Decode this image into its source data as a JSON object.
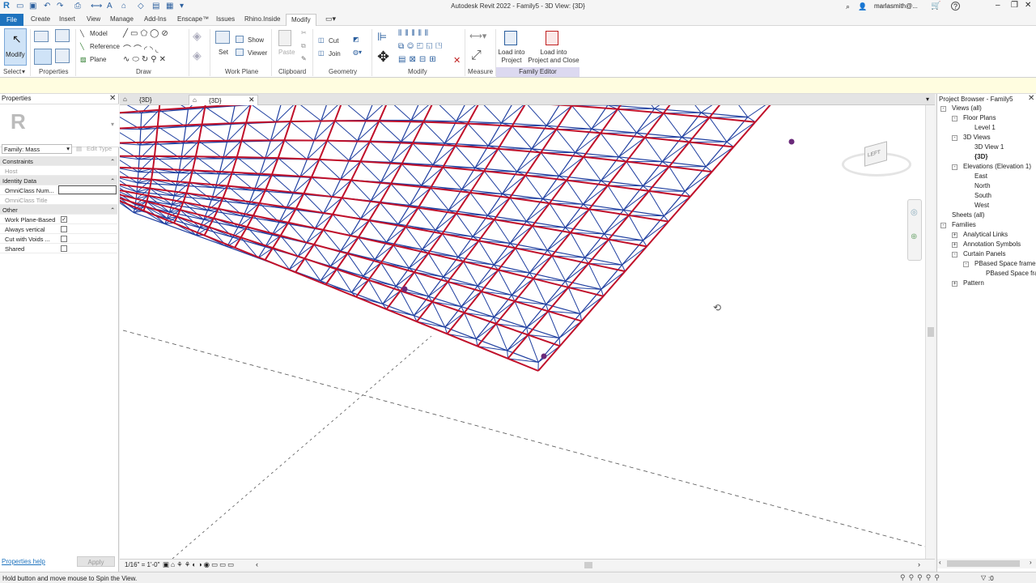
{
  "window": {
    "title": "Autodesk Revit 2022 - Family5 - 3D View: {3D}",
    "user": "marlasmith@...",
    "help": "?"
  },
  "ribbon": {
    "tabs": [
      "File",
      "Create",
      "Insert",
      "View",
      "Manage",
      "Add-Ins",
      "Enscape™",
      "Issues",
      "Rhino.Inside",
      "Modify"
    ],
    "active_tab": "Modify",
    "select_panel": {
      "modify_label": "Modify",
      "select_label": "Select"
    },
    "properties_panel": {
      "label": "Properties"
    },
    "draw_panel": {
      "label": "Draw",
      "model": "Model",
      "reference": "Reference",
      "plane": "Plane"
    },
    "work_plane_panel": {
      "label": "Work Plane",
      "set": "Set",
      "show": "Show",
      "viewer": "Viewer"
    },
    "clipboard_panel": {
      "label": "Clipboard",
      "paste": "Paste"
    },
    "geometry_panel": {
      "label": "Geometry",
      "cut": "Cut",
      "join": "Join"
    },
    "modify_panel": {
      "label": "Modify"
    },
    "measure_panel": {
      "label": "Measure"
    },
    "family_editor_panel": {
      "label": "Family Editor",
      "load_into_project": "Load into\nProject",
      "load_into_project_close": "Load into\nProject and Close"
    }
  },
  "properties": {
    "title": "Properties",
    "type_selector": "Family: Mass",
    "edit_type": "Edit Type",
    "groups": [
      {
        "name": "Constraints",
        "rows": [
          {
            "label": "Host",
            "value": ""
          }
        ]
      },
      {
        "name": "Identity Data",
        "rows": [
          {
            "label": "OmniClass Num...",
            "value": ""
          },
          {
            "label": "OmniClass Title",
            "value": ""
          }
        ]
      },
      {
        "name": "Other",
        "rows": [
          {
            "label": "Work Plane-Based",
            "checked": true
          },
          {
            "label": "Always vertical",
            "checked": false
          },
          {
            "label": "Cut with Voids ...",
            "checked": false
          },
          {
            "label": "Shared",
            "checked": false
          }
        ]
      }
    ],
    "help_link": "Properties help",
    "apply_label": "Apply"
  },
  "view_tabs": [
    {
      "label": "{3D}",
      "active": false
    },
    {
      "label": "{3D}",
      "active": true
    }
  ],
  "viewcube": {
    "face_label": "LEFT"
  },
  "view_control": {
    "scale": "1/16\" = 1'-0\""
  },
  "project_browser": {
    "title": "Project Browser - Family5",
    "items": [
      {
        "label": "Views (all)",
        "depth": 0,
        "toggle": "-"
      },
      {
        "label": "Floor Plans",
        "depth": 1,
        "toggle": "-"
      },
      {
        "label": "Level 1",
        "depth": 2,
        "toggle": ""
      },
      {
        "label": "3D Views",
        "depth": 1,
        "toggle": "-"
      },
      {
        "label": "3D View 1",
        "depth": 2,
        "toggle": ""
      },
      {
        "label": "{3D}",
        "depth": 2,
        "toggle": "",
        "bold": true
      },
      {
        "label": "Elevations (Elevation 1)",
        "depth": 1,
        "toggle": "-"
      },
      {
        "label": "East",
        "depth": 2,
        "toggle": ""
      },
      {
        "label": "North",
        "depth": 2,
        "toggle": ""
      },
      {
        "label": "South",
        "depth": 2,
        "toggle": ""
      },
      {
        "label": "West",
        "depth": 2,
        "toggle": ""
      },
      {
        "label": "Sheets (all)",
        "depth": 0,
        "toggle": ""
      },
      {
        "label": "Families",
        "depth": 0,
        "toggle": "-"
      },
      {
        "label": "Analytical Links",
        "depth": 1,
        "toggle": "+"
      },
      {
        "label": "Annotation Symbols",
        "depth": 1,
        "toggle": "+"
      },
      {
        "label": "Curtain Panels",
        "depth": 1,
        "toggle": "-"
      },
      {
        "label": "PBased Space frame",
        "depth": 2,
        "toggle": "-"
      },
      {
        "label": "PBased Space frame",
        "depth": 3,
        "toggle": ""
      },
      {
        "label": "Pattern",
        "depth": 1,
        "toggle": "+"
      }
    ]
  },
  "status": {
    "message": "Hold button and move mouse to Spin the View.",
    "filter_count": ":0"
  },
  "colors": {
    "accent": "#1e73be",
    "chord_red": "#c0102a",
    "diag_blue": "#1f3fa0",
    "family_editor": "#dcd9f0"
  }
}
